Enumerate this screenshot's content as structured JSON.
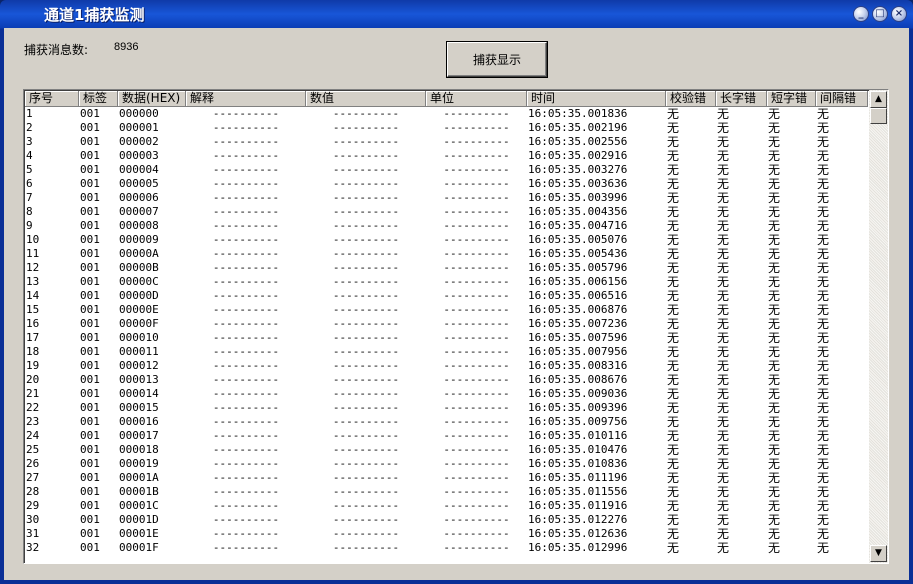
{
  "window": {
    "title": "通道1捕获监测",
    "min_glyph": "_",
    "max_glyph": "□",
    "close_glyph": "×"
  },
  "summary": {
    "count_label": "捕获消息数:",
    "count_value": "8936"
  },
  "toolbar": {
    "capture_label": "捕获显示"
  },
  "table": {
    "columns": [
      "序号",
      "标签",
      "数据(HEX)",
      "解释",
      "数值",
      "单位",
      "时间",
      "校验错",
      "长字错",
      "短字错",
      "间隔错"
    ],
    "rows": [
      [
        "1",
        "001",
        "000000",
        "----------",
        "----------",
        "----------",
        "16:05:35.001836",
        "无",
        "无",
        "无",
        "无"
      ],
      [
        "2",
        "001",
        "000001",
        "----------",
        "----------",
        "----------",
        "16:05:35.002196",
        "无",
        "无",
        "无",
        "无"
      ],
      [
        "3",
        "001",
        "000002",
        "----------",
        "----------",
        "----------",
        "16:05:35.002556",
        "无",
        "无",
        "无",
        "无"
      ],
      [
        "4",
        "001",
        "000003",
        "----------",
        "----------",
        "----------",
        "16:05:35.002916",
        "无",
        "无",
        "无",
        "无"
      ],
      [
        "5",
        "001",
        "000004",
        "----------",
        "----------",
        "----------",
        "16:05:35.003276",
        "无",
        "无",
        "无",
        "无"
      ],
      [
        "6",
        "001",
        "000005",
        "----------",
        "----------",
        "----------",
        "16:05:35.003636",
        "无",
        "无",
        "无",
        "无"
      ],
      [
        "7",
        "001",
        "000006",
        "----------",
        "----------",
        "----------",
        "16:05:35.003996",
        "无",
        "无",
        "无",
        "无"
      ],
      [
        "8",
        "001",
        "000007",
        "----------",
        "----------",
        "----------",
        "16:05:35.004356",
        "无",
        "无",
        "无",
        "无"
      ],
      [
        "9",
        "001",
        "000008",
        "----------",
        "----------",
        "----------",
        "16:05:35.004716",
        "无",
        "无",
        "无",
        "无"
      ],
      [
        "10",
        "001",
        "000009",
        "----------",
        "----------",
        "----------",
        "16:05:35.005076",
        "无",
        "无",
        "无",
        "无"
      ],
      [
        "11",
        "001",
        "00000A",
        "----------",
        "----------",
        "----------",
        "16:05:35.005436",
        "无",
        "无",
        "无",
        "无"
      ],
      [
        "12",
        "001",
        "00000B",
        "----------",
        "----------",
        "----------",
        "16:05:35.005796",
        "无",
        "无",
        "无",
        "无"
      ],
      [
        "13",
        "001",
        "00000C",
        "----------",
        "----------",
        "----------",
        "16:05:35.006156",
        "无",
        "无",
        "无",
        "无"
      ],
      [
        "14",
        "001",
        "00000D",
        "----------",
        "----------",
        "----------",
        "16:05:35.006516",
        "无",
        "无",
        "无",
        "无"
      ],
      [
        "15",
        "001",
        "00000E",
        "----------",
        "----------",
        "----------",
        "16:05:35.006876",
        "无",
        "无",
        "无",
        "无"
      ],
      [
        "16",
        "001",
        "00000F",
        "----------",
        "----------",
        "----------",
        "16:05:35.007236",
        "无",
        "无",
        "无",
        "无"
      ],
      [
        "17",
        "001",
        "000010",
        "----------",
        "----------",
        "----------",
        "16:05:35.007596",
        "无",
        "无",
        "无",
        "无"
      ],
      [
        "18",
        "001",
        "000011",
        "----------",
        "----------",
        "----------",
        "16:05:35.007956",
        "无",
        "无",
        "无",
        "无"
      ],
      [
        "19",
        "001",
        "000012",
        "----------",
        "----------",
        "----------",
        "16:05:35.008316",
        "无",
        "无",
        "无",
        "无"
      ],
      [
        "20",
        "001",
        "000013",
        "----------",
        "----------",
        "----------",
        "16:05:35.008676",
        "无",
        "无",
        "无",
        "无"
      ],
      [
        "21",
        "001",
        "000014",
        "----------",
        "----------",
        "----------",
        "16:05:35.009036",
        "无",
        "无",
        "无",
        "无"
      ],
      [
        "22",
        "001",
        "000015",
        "----------",
        "----------",
        "----------",
        "16:05:35.009396",
        "无",
        "无",
        "无",
        "无"
      ],
      [
        "23",
        "001",
        "000016",
        "----------",
        "----------",
        "----------",
        "16:05:35.009756",
        "无",
        "无",
        "无",
        "无"
      ],
      [
        "24",
        "001",
        "000017",
        "----------",
        "----------",
        "----------",
        "16:05:35.010116",
        "无",
        "无",
        "无",
        "无"
      ],
      [
        "25",
        "001",
        "000018",
        "----------",
        "----------",
        "----------",
        "16:05:35.010476",
        "无",
        "无",
        "无",
        "无"
      ],
      [
        "26",
        "001",
        "000019",
        "----------",
        "----------",
        "----------",
        "16:05:35.010836",
        "无",
        "无",
        "无",
        "无"
      ],
      [
        "27",
        "001",
        "00001A",
        "----------",
        "----------",
        "----------",
        "16:05:35.011196",
        "无",
        "无",
        "无",
        "无"
      ],
      [
        "28",
        "001",
        "00001B",
        "----------",
        "----------",
        "----------",
        "16:05:35.011556",
        "无",
        "无",
        "无",
        "无"
      ],
      [
        "29",
        "001",
        "00001C",
        "----------",
        "----------",
        "----------",
        "16:05:35.011916",
        "无",
        "无",
        "无",
        "无"
      ],
      [
        "30",
        "001",
        "00001D",
        "----------",
        "----------",
        "----------",
        "16:05:35.012276",
        "无",
        "无",
        "无",
        "无"
      ],
      [
        "31",
        "001",
        "00001E",
        "----------",
        "----------",
        "----------",
        "16:05:35.012636",
        "无",
        "无",
        "无",
        "无"
      ],
      [
        "32",
        "001",
        "00001F",
        "----------",
        "----------",
        "----------",
        "16:05:35.012996",
        "无",
        "无",
        "无",
        "无"
      ]
    ]
  },
  "scrollbar": {
    "up_glyph": "▲",
    "down_glyph": "▼"
  }
}
